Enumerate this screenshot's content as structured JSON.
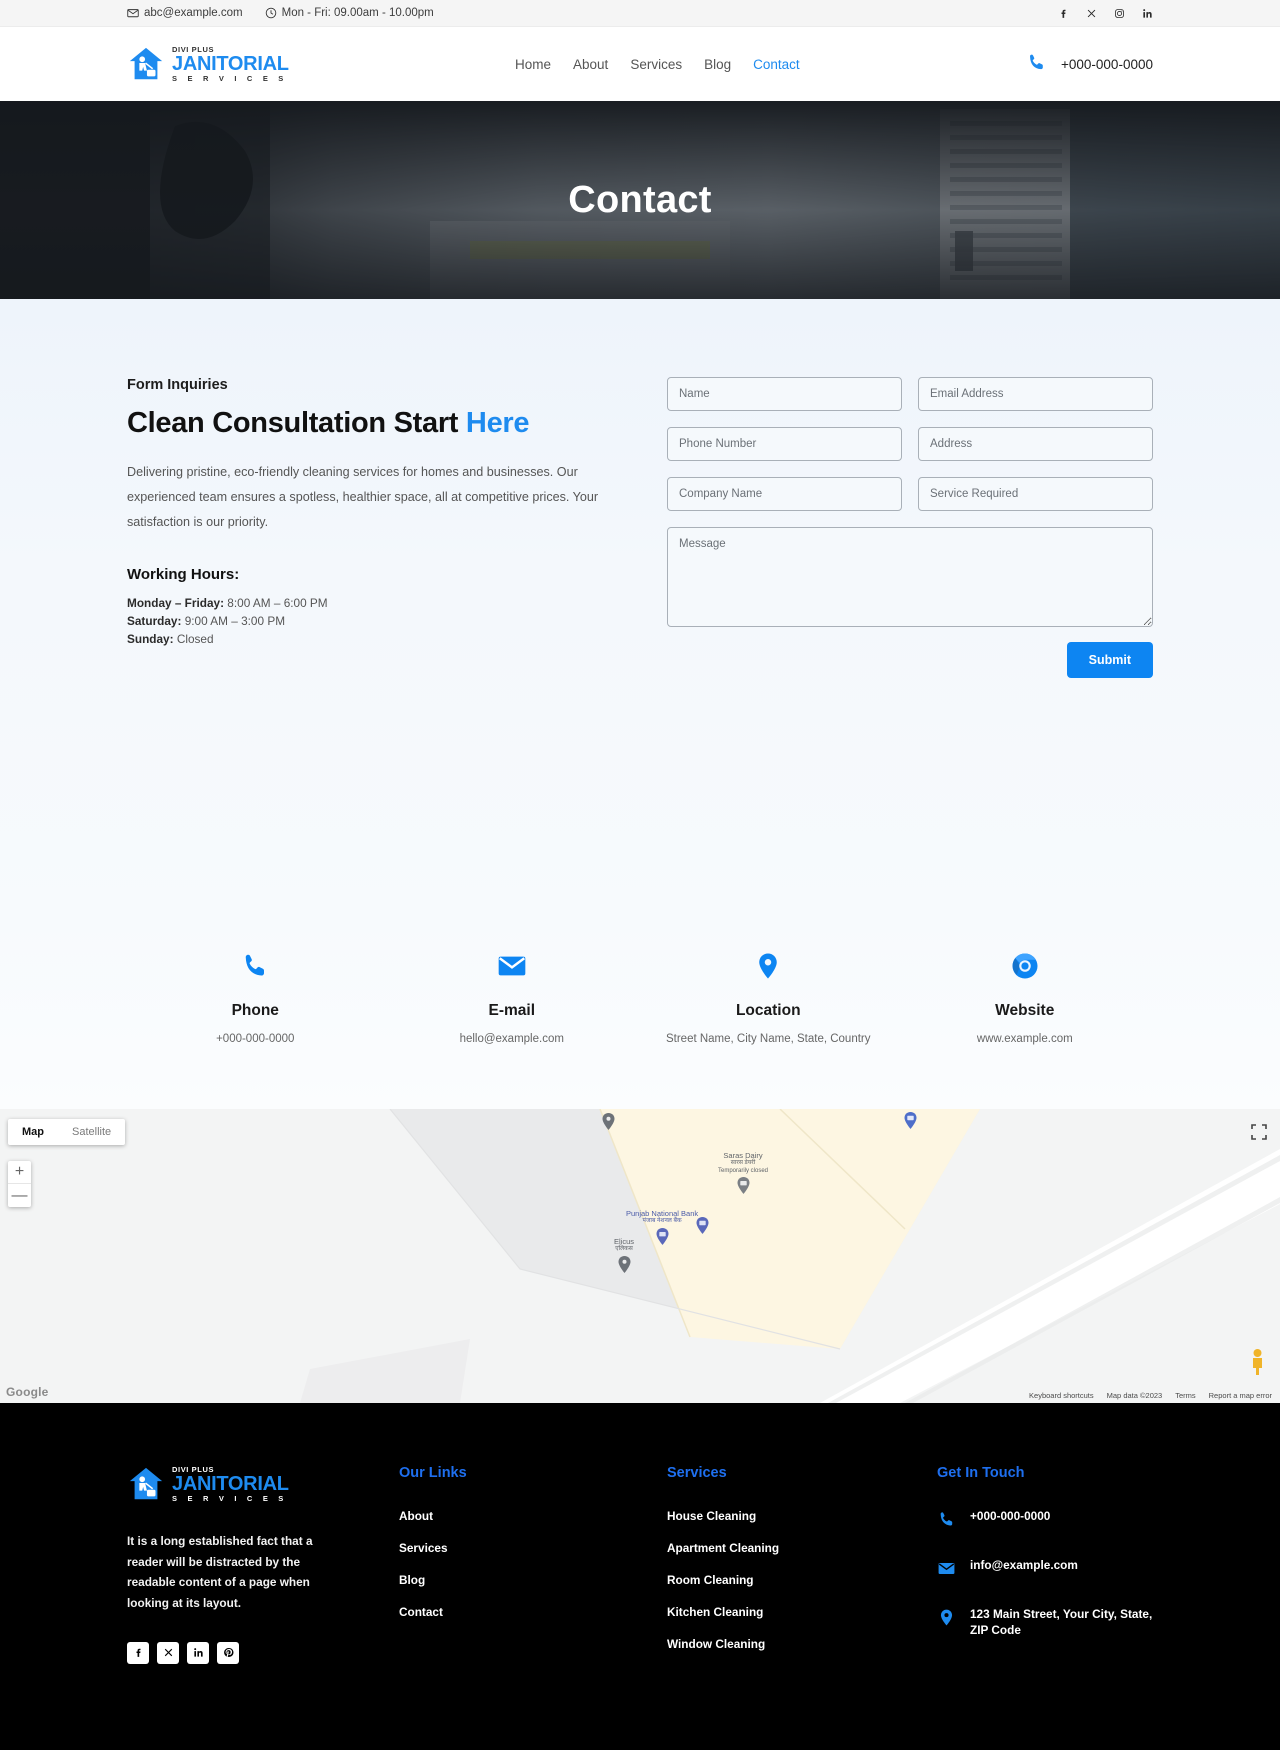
{
  "topbar": {
    "email": "abc@example.com",
    "hours": "Mon - Fri: 09.00am - 10.00pm",
    "socials": [
      {
        "name": "facebook",
        "glyph": "f"
      },
      {
        "name": "x-twitter",
        "glyph": "X"
      },
      {
        "name": "instagram",
        "glyph": "▢"
      },
      {
        "name": "linkedin",
        "glyph": "in"
      }
    ]
  },
  "brand": {
    "top": "DIVI PLUS",
    "main": "JANITORIAL",
    "sub": "S E R V I C E S"
  },
  "nav": {
    "items": [
      {
        "label": "Home",
        "active": false
      },
      {
        "label": "About",
        "active": false
      },
      {
        "label": "Services",
        "active": false
      },
      {
        "label": "Blog",
        "active": false
      },
      {
        "label": "Contact",
        "active": true
      }
    ],
    "phone": "+000-000-0000"
  },
  "hero": {
    "title": "Contact"
  },
  "contact": {
    "eyebrow": "Form Inquiries",
    "headline_plain": "Clean Consultation Start ",
    "headline_accent": "Here",
    "lede": "Delivering pristine, eco-friendly cleaning services for homes and businesses. Our experienced team ensures a spotless, healthier space, all at competitive prices. Your satisfaction is our priority.",
    "working_hours_title": "Working Hours:",
    "hours": [
      {
        "day": "Monday – Friday:",
        "time": " 8:00 AM – 6:00 PM"
      },
      {
        "day": "Saturday:",
        "time": " 9:00 AM – 3:00 PM"
      },
      {
        "day": "Sunday:",
        "time": " Closed"
      }
    ]
  },
  "form": {
    "name": "Name",
    "email": "Email Address",
    "phone": "Phone Number",
    "address": "Address",
    "company": "Company Name",
    "service": "Service Required",
    "message": "Message",
    "submit": "Submit"
  },
  "cards": [
    {
      "icon": "phone-icon",
      "title": "Phone",
      "sub": "+000-000-0000"
    },
    {
      "icon": "envelope-icon",
      "title": "E-mail",
      "sub": "hello@example.com"
    },
    {
      "icon": "map-pin-icon",
      "title": "Location",
      "sub": "Street Name, City Name, State, Country"
    },
    {
      "icon": "chrome-icon",
      "title": "Website",
      "sub": "www.example.com"
    }
  ],
  "map": {
    "type_map": "Map",
    "type_satellite": "Satellite",
    "zoom_in": "+",
    "zoom_out": "—",
    "logo": "Google",
    "credits": [
      "Keyboard shortcuts",
      "Map data ©2023",
      "Terms",
      "Report a map error"
    ],
    "pois": [
      {
        "name": "Saras Dairy",
        "native": "सारस डेयरी",
        "status": "Temporarily closed"
      },
      {
        "name": "Punjab National Bank",
        "native": "पंजाब नेशनल बैंक",
        "status": ""
      },
      {
        "name": "Elicus",
        "native": "एलिकस",
        "status": ""
      }
    ]
  },
  "footer": {
    "about_text": "It is a long established fact that a reader will be distracted by the readable content of a page when looking at its layout.",
    "socials": [
      {
        "name": "facebook",
        "glyph": "f"
      },
      {
        "name": "x-twitter",
        "glyph": "X"
      },
      {
        "name": "linkedin",
        "glyph": "in"
      },
      {
        "name": "pinterest",
        "glyph": "P"
      }
    ],
    "links_head": "Our Links",
    "links": [
      "About",
      "Services",
      "Blog",
      "Contact"
    ],
    "services_head": "Services",
    "services": [
      "House Cleaning",
      "Apartment Cleaning",
      "Room Cleaning",
      "Kitchen Cleaning",
      "Window Cleaning"
    ],
    "touch_head": "Get In Touch",
    "touch": [
      {
        "icon": "phone-icon",
        "text": "+000-000-0000"
      },
      {
        "icon": "envelope-icon",
        "text": "info@example.com"
      },
      {
        "icon": "map-pin-icon",
        "text": "123 Main Street, Your City, State, ZIP Code"
      }
    ]
  },
  "colors": {
    "accent": "#1E8BEF",
    "submit": "#0d85f2",
    "footer_bg": "#000000",
    "footer_head": "#1E6FEF"
  }
}
